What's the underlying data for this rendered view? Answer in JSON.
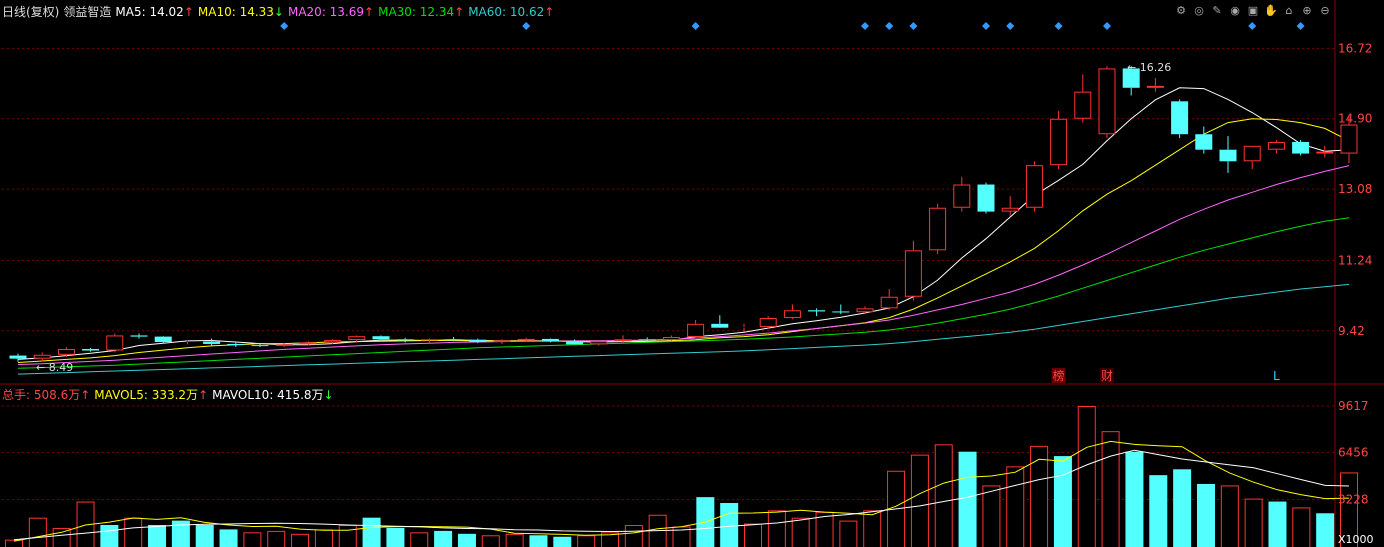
{
  "header": {
    "period": "日线(复权)",
    "stock_name": "领益智造",
    "ma5": {
      "label": "MA5: 14.02",
      "arrow": "↑",
      "color": "#ffffff"
    },
    "ma10": {
      "label": "MA10: 14.33",
      "arrow": "↓",
      "color": "#ffff00"
    },
    "ma20": {
      "label": "MA20: 13.69",
      "arrow": "↑",
      "color": "#ff66ff"
    },
    "ma30": {
      "label": "MA30: 12.34",
      "arrow": "↑",
      "color": "#00e000"
    },
    "ma60": {
      "label": "MA60: 10.62",
      "arrow": "↑",
      "color": "#33cccc"
    }
  },
  "volume_header": {
    "total": {
      "label": "总手: 508.6万",
      "arrow": "↑",
      "color": "#ff4444"
    },
    "mavol5": {
      "label": "MAVOL5: 333.2万",
      "arrow": "↑",
      "color": "#ffff00"
    },
    "mavol10": {
      "label": "MAVOL10: 415.8万",
      "arrow": "↓",
      "color": "#ffffff"
    }
  },
  "toolbar_icons": [
    "settings-icon",
    "target-icon",
    "pen-icon",
    "eye-icon",
    "briefcase-icon",
    "hand-icon",
    "lock-icon",
    "zoom-in-icon",
    "zoom-out-icon"
  ],
  "colors": {
    "up": "#ff3333",
    "down": "#54ffff",
    "grid": "#7a0000",
    "axis_text": "#ff4444",
    "marker": "#3399ff"
  },
  "chart_data": [
    {
      "type": "candlestick",
      "y_ticks": [
        9.42,
        11.24,
        13.08,
        14.9,
        16.72
      ],
      "ylim": [
        8.2,
        17.4
      ],
      "max_label": "16.26",
      "min_label": "8.49",
      "ohlc": [
        [
          8.78,
          8.83,
          8.62,
          8.7
        ],
        [
          8.7,
          8.86,
          8.62,
          8.8
        ],
        [
          8.8,
          9.0,
          8.75,
          8.95
        ],
        [
          8.95,
          8.98,
          8.88,
          8.91
        ],
        [
          8.91,
          9.35,
          8.86,
          9.3
        ],
        [
          9.3,
          9.35,
          9.22,
          9.27
        ],
        [
          9.27,
          9.28,
          9.1,
          9.13
        ],
        [
          9.13,
          9.18,
          9.07,
          9.14
        ],
        [
          9.14,
          9.22,
          9.03,
          9.08
        ],
        [
          9.08,
          9.11,
          9.0,
          9.05
        ],
        [
          9.05,
          9.08,
          9.0,
          9.03
        ],
        [
          9.03,
          9.1,
          9.0,
          9.07
        ],
        [
          9.07,
          9.15,
          9.05,
          9.12
        ],
        [
          9.12,
          9.2,
          9.08,
          9.18
        ],
        [
          9.18,
          9.3,
          9.12,
          9.28
        ],
        [
          9.28,
          9.3,
          9.17,
          9.2
        ],
        [
          9.2,
          9.24,
          9.12,
          9.17
        ],
        [
          9.17,
          9.22,
          9.1,
          9.2
        ],
        [
          9.2,
          9.26,
          9.15,
          9.19
        ],
        [
          9.19,
          9.22,
          9.1,
          9.13
        ],
        [
          9.13,
          9.2,
          9.08,
          9.17
        ],
        [
          9.17,
          9.24,
          9.14,
          9.21
        ],
        [
          9.21,
          9.22,
          9.12,
          9.15
        ],
        [
          9.15,
          9.2,
          9.1,
          9.07
        ],
        [
          9.07,
          9.18,
          9.04,
          9.15
        ],
        [
          9.15,
          9.3,
          9.1,
          9.2
        ],
        [
          9.2,
          9.25,
          9.15,
          9.18
        ],
        [
          9.18,
          9.3,
          9.16,
          9.26
        ],
        [
          9.26,
          9.7,
          9.22,
          9.6
        ],
        [
          9.6,
          9.82,
          9.55,
          9.5
        ],
        [
          9.5,
          9.6,
          9.4,
          9.52
        ],
        [
          9.52,
          9.8,
          9.48,
          9.75
        ],
        [
          9.75,
          10.1,
          9.72,
          9.95
        ],
        [
          9.95,
          10.0,
          9.8,
          9.92
        ],
        [
          9.92,
          10.1,
          9.85,
          9.9
        ],
        [
          9.9,
          10.05,
          9.86,
          10.0
        ],
        [
          10.0,
          10.5,
          9.96,
          10.3
        ],
        [
          10.3,
          11.75,
          10.2,
          11.5
        ],
        [
          11.5,
          12.7,
          11.4,
          12.6
        ],
        [
          12.6,
          13.4,
          12.5,
          13.2
        ],
        [
          13.2,
          13.25,
          12.45,
          12.5
        ],
        [
          12.5,
          12.9,
          12.4,
          12.6
        ],
        [
          12.6,
          13.8,
          12.5,
          13.7
        ],
        [
          13.7,
          15.1,
          13.6,
          14.9
        ],
        [
          14.9,
          16.05,
          14.8,
          15.6
        ],
        [
          14.5,
          16.26,
          14.4,
          16.2
        ],
        [
          16.2,
          16.26,
          15.5,
          15.7
        ],
        [
          15.7,
          15.95,
          15.6,
          15.75
        ],
        [
          15.35,
          15.4,
          14.4,
          14.5
        ],
        [
          14.5,
          14.7,
          14.0,
          14.1
        ],
        [
          14.1,
          14.45,
          13.5,
          13.8
        ],
        [
          13.8,
          14.2,
          13.6,
          14.2
        ],
        [
          14.1,
          14.35,
          14.0,
          14.3
        ],
        [
          14.3,
          14.35,
          13.95,
          14.0
        ],
        [
          14.0,
          14.2,
          13.9,
          14.05
        ],
        [
          14.0,
          15.0,
          13.75,
          14.75
        ]
      ],
      "ma": {
        "MA5": [
          8.68,
          8.72,
          8.78,
          8.84,
          8.91,
          9.04,
          9.1,
          9.16,
          9.17,
          9.13,
          9.09,
          9.06,
          9.06,
          9.09,
          9.14,
          9.18,
          9.18,
          9.17,
          9.19,
          9.17,
          9.16,
          9.16,
          9.16,
          9.14,
          9.13,
          9.14,
          9.14,
          9.17,
          9.27,
          9.32,
          9.38,
          9.49,
          9.6,
          9.68,
          9.77,
          9.88,
          10.01,
          10.3,
          10.73,
          11.3,
          11.8,
          12.36,
          12.92,
          13.31,
          13.72,
          14.33,
          14.9,
          15.39,
          15.7,
          15.68,
          15.4,
          15.06,
          14.67,
          14.25,
          14.06,
          14.1
        ],
        "MA10": [
          8.6,
          8.64,
          8.68,
          8.72,
          8.78,
          8.86,
          8.92,
          8.98,
          9.03,
          9.06,
          9.09,
          9.09,
          9.11,
          9.13,
          9.14,
          9.15,
          9.16,
          9.17,
          9.17,
          9.16,
          9.16,
          9.16,
          9.16,
          9.16,
          9.16,
          9.16,
          9.15,
          9.16,
          9.19,
          9.24,
          9.27,
          9.32,
          9.4,
          9.48,
          9.55,
          9.63,
          9.76,
          9.98,
          10.27,
          10.58,
          10.89,
          11.2,
          11.55,
          12.01,
          12.52,
          12.95,
          13.3,
          13.7,
          14.1,
          14.5,
          14.8,
          14.9,
          14.88,
          14.8,
          14.65,
          14.33
        ],
        "MA20": [
          8.55,
          8.57,
          8.6,
          8.63,
          8.66,
          8.7,
          8.74,
          8.78,
          8.82,
          8.86,
          8.9,
          8.94,
          8.97,
          9.0,
          9.03,
          9.06,
          9.08,
          9.1,
          9.12,
          9.13,
          9.14,
          9.15,
          9.15,
          9.16,
          9.16,
          9.17,
          9.18,
          9.2,
          9.23,
          9.27,
          9.31,
          9.36,
          9.42,
          9.48,
          9.55,
          9.62,
          9.7,
          9.82,
          9.96,
          10.1,
          10.26,
          10.42,
          10.62,
          10.86,
          11.12,
          11.4,
          11.7,
          12.0,
          12.3,
          12.56,
          12.8,
          13.0,
          13.2,
          13.38,
          13.54,
          13.69
        ],
        "MA30": [
          8.45,
          8.47,
          8.49,
          8.51,
          8.53,
          8.56,
          8.59,
          8.62,
          8.65,
          8.68,
          8.71,
          8.74,
          8.77,
          8.8,
          8.83,
          8.86,
          8.89,
          8.92,
          8.95,
          8.98,
          9.0,
          9.02,
          9.04,
          9.06,
          9.08,
          9.1,
          9.12,
          9.14,
          9.16,
          9.18,
          9.2,
          9.23,
          9.26,
          9.3,
          9.34,
          9.38,
          9.44,
          9.52,
          9.62,
          9.73,
          9.85,
          9.98,
          10.14,
          10.32,
          10.52,
          10.72,
          10.92,
          11.12,
          11.32,
          11.5,
          11.66,
          11.82,
          11.98,
          12.12,
          12.25,
          12.34
        ],
        "MA60": [
          8.3,
          8.32,
          8.34,
          8.36,
          8.38,
          8.4,
          8.42,
          8.44,
          8.46,
          8.48,
          8.5,
          8.52,
          8.54,
          8.56,
          8.58,
          8.6,
          8.62,
          8.64,
          8.66,
          8.68,
          8.7,
          8.72,
          8.74,
          8.76,
          8.78,
          8.8,
          8.82,
          8.84,
          8.86,
          8.88,
          8.9,
          8.93,
          8.96,
          8.99,
          9.02,
          9.05,
          9.09,
          9.14,
          9.2,
          9.26,
          9.32,
          9.38,
          9.46,
          9.56,
          9.66,
          9.76,
          9.86,
          9.96,
          10.06,
          10.16,
          10.26,
          10.34,
          10.42,
          10.5,
          10.56,
          10.62
        ]
      },
      "marker_days": [
        11,
        21,
        28,
        35,
        36,
        37,
        40,
        41,
        43,
        45,
        51,
        53
      ],
      "event_labels": [
        {
          "day": 43,
          "text": "榜",
          "color": "#ff4444",
          "bg": "#660000"
        },
        {
          "day": 45,
          "text": "财",
          "color": "#ff4444",
          "bg": "#330000"
        },
        {
          "day": 52,
          "text": "L",
          "color": "#33ccff",
          "bg": ""
        }
      ]
    },
    {
      "type": "bar",
      "unit": "X1000",
      "y_ticks": [
        3228,
        6456,
        9617
      ],
      "ylim": [
        0,
        9617
      ],
      "volumes": [
        500,
        2000,
        1300,
        3100,
        1500,
        2000,
        1500,
        1800,
        1500,
        1200,
        1000,
        1100,
        900,
        1200,
        1500,
        2000,
        1300,
        1000,
        1100,
        900,
        800,
        900,
        800,
        700,
        800,
        1000,
        1500,
        2200,
        1400,
        3400,
        3000,
        1600,
        2500,
        2000,
        2400,
        1800,
        2500,
        5200,
        6300,
        7000,
        6500,
        4200,
        5500,
        6900,
        6200,
        9617,
        7900,
        6500,
        4900,
        5300,
        4300,
        4200,
        3300,
        3100,
        2700,
        2300,
        5086
      ],
      "up": [
        true,
        true,
        true,
        true,
        false,
        true,
        false,
        false,
        false,
        false,
        true,
        true,
        true,
        true,
        true,
        false,
        false,
        true,
        false,
        false,
        true,
        true,
        false,
        false,
        true,
        true,
        true,
        true,
        true,
        false,
        false,
        true,
        true,
        true,
        true,
        true,
        true,
        true,
        true,
        true,
        false,
        true,
        true,
        true,
        false,
        true,
        true,
        false,
        false,
        false,
        false,
        true,
        true,
        false,
        true,
        false,
        true
      ],
      "mavol5": [
        400,
        700,
        1000,
        1500,
        1700,
        1980,
        1880,
        2000,
        1680,
        1500,
        1400,
        1420,
        1220,
        1140,
        1140,
        1340,
        1380,
        1400,
        1380,
        1360,
        1220,
        940,
        900,
        860,
        800,
        840,
        960,
        1240,
        1380,
        1700,
        2300,
        2320,
        2380,
        2500,
        2380,
        2300,
        2200,
        2780,
        3640,
        4360,
        4760,
        4840,
        5100,
        5980,
        5860,
        6800,
        7200,
        7000,
        6900,
        6840,
        5860,
        5040,
        4420,
        3900,
        3560,
        3300,
        3332
      ],
      "mavol10": [
        500,
        650,
        800,
        950,
        1100,
        1300,
        1400,
        1500,
        1550,
        1570,
        1600,
        1620,
        1600,
        1560,
        1500,
        1460,
        1420,
        1380,
        1300,
        1260,
        1240,
        1180,
        1160,
        1100,
        1080,
        1060,
        1080,
        1120,
        1160,
        1260,
        1420,
        1520,
        1640,
        1840,
        2080,
        2220,
        2400,
        2600,
        2800,
        3100,
        3400,
        3800,
        4200,
        4600,
        4900,
        5600,
        6200,
        6600,
        6300,
        6000,
        5800,
        5600,
        5400,
        5000,
        4600,
        4200,
        4158
      ]
    }
  ]
}
